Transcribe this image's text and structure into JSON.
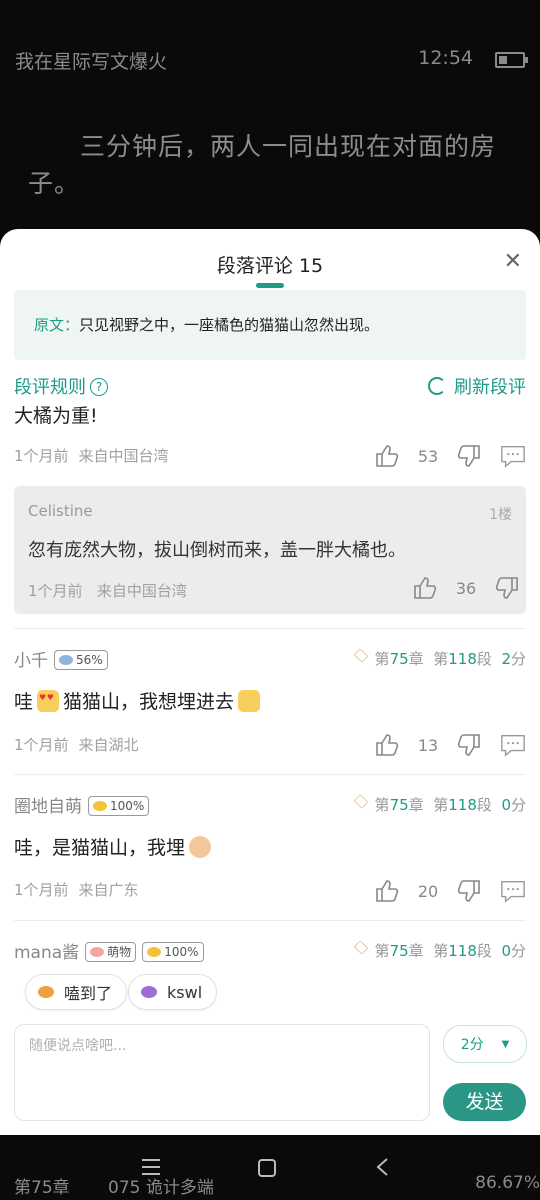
{
  "reader": {
    "book_title": "我在星际写文爆火",
    "time": "12:54",
    "battery_level": 0.35,
    "paragraph": "三分钟后，两人一同出现在对面的房子。",
    "footer_chapter": "第75章",
    "footer_chapter_title": "075 诡计多端",
    "progress": "86.67%"
  },
  "sheet": {
    "title": "段落评论 15",
    "close_symbol": "✕",
    "quote_label": "原文：",
    "quote_text": "只见视野之中，一座橘色的猫猫山忽然出现。",
    "rules_label": "段评规则",
    "refresh_label": "刷新段评"
  },
  "comments": [
    {
      "text": "大橘为重!",
      "time": "1个月前",
      "location": "来自中国台湾",
      "likes": "53"
    },
    {
      "user": "小千",
      "badge": "56%",
      "chapter_prefix": "第",
      "chapter_num": "75",
      "chapter_unit": "章",
      "para_prefix": "第",
      "para_num": "118",
      "para_unit": "段",
      "score_num": "2",
      "score_unit": "分",
      "text_a": "哇",
      "text_b": "猫猫山，我想埋进去",
      "time": "1个月前",
      "location": "来自湖北",
      "likes": "13"
    },
    {
      "user": "圈地自萌",
      "badge": "100%",
      "chapter_prefix": "第",
      "chapter_num": "75",
      "chapter_unit": "章",
      "para_prefix": "第",
      "para_num": "118",
      "para_unit": "段",
      "score_num": "0",
      "score_unit": "分",
      "text": "哇，是猫猫山，我埋",
      "time": "1个月前",
      "location": "来自广东",
      "likes": "20"
    },
    {
      "user": "mana酱",
      "badge1": "萌物",
      "badge2": "100%",
      "chapter_prefix": "第",
      "chapter_num": "75",
      "chapter_unit": "章",
      "para_prefix": "第",
      "para_num": "118",
      "para_unit": "段",
      "score_num": "0",
      "score_unit": "分"
    }
  ],
  "reply": {
    "user": "Celistine",
    "floor": "1楼",
    "text": "忽有庞然大物，拔山倒树而来，盖一胖大橘也。",
    "time": "1个月前",
    "location": "来自中国台湾",
    "likes": "36"
  },
  "tags": [
    {
      "label": "嗑到了",
      "icon": "candy-icon",
      "color": "#f0a03c"
    },
    {
      "label": "kswl",
      "icon": "candy-icon",
      "color": "#9a6fd6"
    }
  ],
  "composer": {
    "placeholder": "随便说点啥吧...",
    "score_label": "2分",
    "score_arrow": "▼",
    "send_label": "发送"
  },
  "colors": {
    "accent": "#1e9c88",
    "send": "#2a9685"
  }
}
